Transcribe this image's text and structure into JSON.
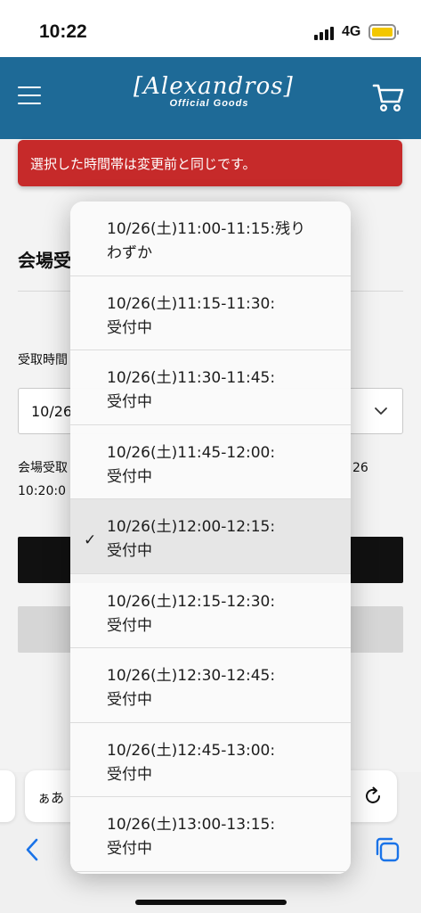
{
  "status_bar": {
    "time": "10:22",
    "network": "4G"
  },
  "header": {
    "logo_text": "[Alexandros]",
    "logo_subtitle": "Official Goods"
  },
  "error_banner": {
    "message": "選択した時間帯は変更前と同じです。"
  },
  "page": {
    "section_title": "会場受",
    "field_label": "受取時間",
    "select_value": "10/26",
    "note_line1": "会場受取",
    "note_line1_right": "26",
    "note_line2": "10:20:0"
  },
  "browser": {
    "aa_label": "ぁあ"
  },
  "dropdown": {
    "options": [
      {
        "line1": "10/26(土)11:00-11:15:残り",
        "line2": "わずか",
        "selected": false
      },
      {
        "line1": "10/26(土)11:15-11:30:",
        "line2": "受付中",
        "selected": false
      },
      {
        "line1": "10/26(土)11:30-11:45:",
        "line2": "受付中",
        "selected": false
      },
      {
        "line1": "10/26(土)11:45-12:00:",
        "line2": "受付中",
        "selected": false
      },
      {
        "line1": "10/26(土)12:00-12:15:",
        "line2": "受付中",
        "selected": true
      },
      {
        "line1": "10/26(土)12:15-12:30:",
        "line2": "受付中",
        "selected": false
      },
      {
        "line1": "10/26(土)12:30-12:45:",
        "line2": "受付中",
        "selected": false
      },
      {
        "line1": "10/26(土)12:45-13:00:",
        "line2": "受付中",
        "selected": false
      },
      {
        "line1": "10/26(土)13:00-13:15:",
        "line2": "受付中",
        "selected": false
      }
    ],
    "check_mark": "✓"
  },
  "colors": {
    "header_bg": "#1e6a97",
    "error_bg": "#c62a2a",
    "battery": "#f3c700",
    "link_blue": "#1a73e8"
  }
}
